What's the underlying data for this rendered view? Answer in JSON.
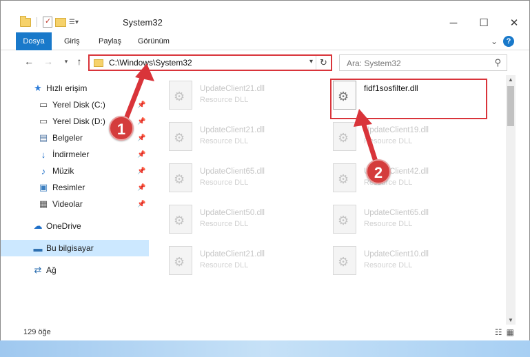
{
  "window": {
    "title": "System32",
    "controls": [
      "─",
      "☐",
      "✕"
    ]
  },
  "ribbon": {
    "tabs": [
      "Dosya",
      "Giriş",
      "Paylaş",
      "Görünüm"
    ]
  },
  "address": {
    "path": "C:\\Windows\\System32",
    "search_placeholder": "Ara: System32"
  },
  "sidebar": {
    "items": [
      {
        "label": "Hızlı erişim",
        "icon": "star-icon"
      },
      {
        "label": "Yerel Disk (C:)",
        "icon": "drive-icon",
        "pinned": true
      },
      {
        "label": "Yerel Disk (D:)",
        "icon": "drive-icon",
        "pinned": true
      },
      {
        "label": "Belgeler",
        "icon": "documents-icon",
        "pinned": true
      },
      {
        "label": "İndirmeler",
        "icon": "download-icon",
        "pinned": true
      },
      {
        "label": "Müzik",
        "icon": "music-icon",
        "pinned": true
      },
      {
        "label": "Resimler",
        "icon": "pictures-icon",
        "pinned": true
      },
      {
        "label": "Videolar",
        "icon": "video-icon",
        "pinned": true
      },
      {
        "label": "OneDrive",
        "icon": "cloud-icon"
      },
      {
        "label": "Bu bilgisayar",
        "icon": "computer-icon",
        "selected": true
      },
      {
        "label": "Ağ",
        "icon": "network-icon"
      }
    ]
  },
  "files": [
    {
      "name": "UpdateClient21.dll",
      "desc": "Resource DLL"
    },
    {
      "name": "fidf1sosfilter.dll",
      "desc": "",
      "highlight": true
    },
    {
      "name": "UpdateClient21.dll",
      "desc": "Resource DLL"
    },
    {
      "name": "UpdateClient19.dll",
      "desc": "Resource DLL"
    },
    {
      "name": "UpdateClient65.dll",
      "desc": "Resource DLL"
    },
    {
      "name": "UpdateClient42.dll",
      "desc": "Resource DLL"
    },
    {
      "name": "UpdateClient50.dll",
      "desc": "Resource DLL"
    },
    {
      "name": "UpdateClient65.dll",
      "desc": "Resource DLL"
    },
    {
      "name": "UpdateClient21.dll",
      "desc": "Resource DLL"
    },
    {
      "name": "UpdateClient10.dll",
      "desc": "Resource DLL"
    }
  ],
  "status": {
    "count": "129 öğe"
  },
  "annotations": [
    "1",
    "2"
  ],
  "colors": {
    "accent": "#1979ca",
    "annotation": "#d9343a",
    "selection": "#cce8ff"
  }
}
